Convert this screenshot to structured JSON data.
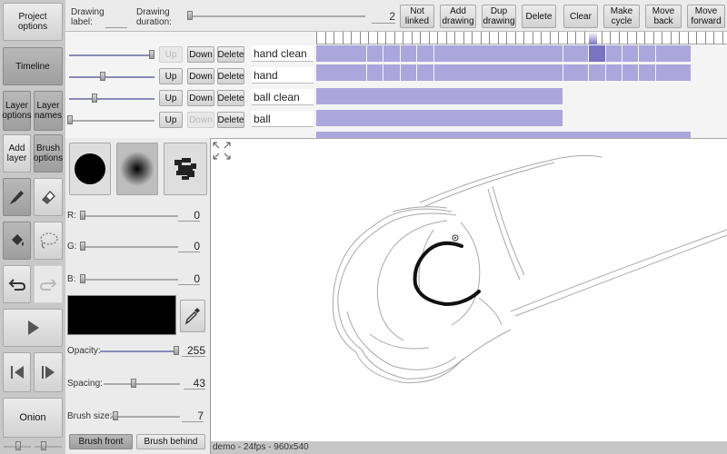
{
  "left": {
    "project_options": "Project options",
    "timeline": "Timeline",
    "layer_options": "Layer options",
    "layer_names": "Layer names",
    "add_layer": "Add layer",
    "brush_options": "Brush options",
    "onion": "Onion"
  },
  "topbar": {
    "drawing_label_caption": "Drawing label:",
    "drawing_duration_caption": "Drawing duration:",
    "duration_value": "2",
    "not_linked": "Not linked",
    "add_drawing": "Add drawing",
    "dup_drawing": "Dup drawing",
    "delete": "Delete",
    "clear": "Clear",
    "make_cycle": "Make cycle",
    "move_back": "Move back",
    "move_forward": "Move forward"
  },
  "timeline": {
    "current_frame": "1",
    "up": "Up",
    "down": "Down",
    "delete": "Delete",
    "layers": [
      {
        "name": "hand clean",
        "opacity": 1.0
      },
      {
        "name": "hand",
        "opacity": 0.4
      },
      {
        "name": "ball clean",
        "opacity": 0.3
      },
      {
        "name": "ball",
        "opacity": 0.0
      }
    ]
  },
  "brush": {
    "r_label": "R:",
    "r_value": "0",
    "g_label": "G:",
    "g_value": "0",
    "b_label": "B:",
    "b_value": "0",
    "opacity_label": "Opacity:",
    "opacity_value": "255",
    "spacing_label": "Spacing:",
    "spacing_value": "43",
    "size_label": "Brush size:",
    "size_value": "7",
    "brush_front": "Brush front",
    "brush_behind": "Brush behind",
    "color": "#000000"
  },
  "status": {
    "text": "demo - 24fps - 960x540"
  },
  "colors": {
    "cell": "#aba6dc",
    "cell_selected": "#7a73c2"
  }
}
